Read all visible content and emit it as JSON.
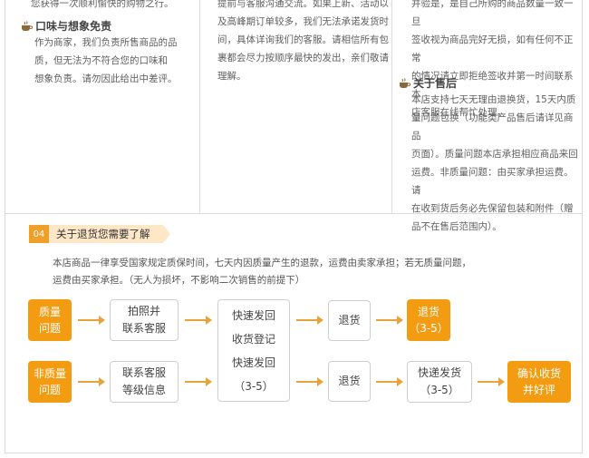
{
  "col1": {
    "top_line": "您获得一次顺利愉快的购物之行。",
    "section_title": "口味与想象免责",
    "lines": [
      "作为商家，我们负责所售商品的品",
      "质，但无法为不符合您的口味和",
      "想象负责。请勿因此给出中差评。"
    ]
  },
  "col2": {
    "lines": [
      "提前与客服沟通交流。如果上新、活动以",
      "及高峰期订单较多，我们无法承诺发货时",
      "间，具体详询我们的客服。请相信所有包",
      "裹都会尽力按顺序最快的发出，亲们敬请",
      "理解。"
    ]
  },
  "col3": {
    "top_lines": [
      "并验是，是自己所购的商品数量一致一旦",
      "签收视为商品完好无损，如有任何不正常",
      "的情况请立即拒绝签收并第一时间联系本",
      "店客服在线帮忙处理。"
    ],
    "section_title": "关于售后",
    "lines": [
      "本店支持七天无理由退换货，15天内质",
      "量问题包换（功能类产品售后请详见商品",
      "页面）。质量问题本店承担相应商品来回",
      "运费。非质量问题：由买家承担运费。请",
      "在收到货后务必先保留包装和附件（赠",
      "品不在售后范围内）。"
    ]
  },
  "banner": {
    "number": "04",
    "title": "关于退货您需要了解"
  },
  "intro": [
    "本店商品一律享受国家规定质保时间，七天内因质量产生的退款，运费由卖家承担；若无质量问题，",
    "运费由买家承担。（无人为损坏，不影响二次销售的前提下）"
  ],
  "flow": {
    "quality_issue": [
      "质量",
      "问题"
    ],
    "non_quality_issue": [
      "非质量",
      "问题"
    ],
    "photo_contact": [
      "拍照并",
      "联系客服"
    ],
    "contact_register": [
      "联系客服",
      "等级信息"
    ],
    "center_steps": [
      "快速发回",
      "收货登记",
      "快速发回",
      "（3-5）"
    ],
    "return_top": "退货",
    "return_bottom": "退货",
    "refund_result": [
      "退货",
      "（3-5）"
    ],
    "express_ship": [
      "快递发货",
      "（3-5）"
    ],
    "confirm_receipt": [
      "确认收货",
      "并好评"
    ]
  },
  "colors": {
    "accent": "#f39c12",
    "arrow": "#e8a33b",
    "banner_bg": "#fde7c6"
  }
}
